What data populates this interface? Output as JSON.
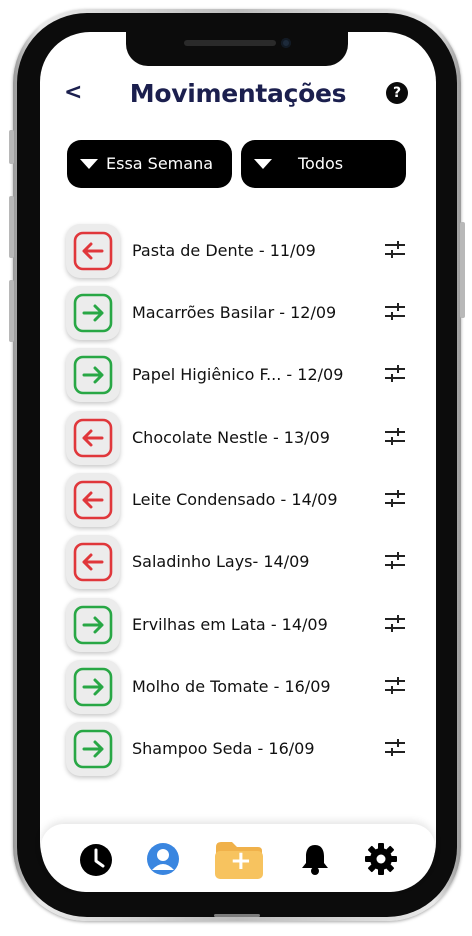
{
  "header": {
    "title": "Movimentações",
    "back_glyph": "<",
    "help_glyph": "?"
  },
  "filters": {
    "period": "Essa Semana",
    "type": "Todos"
  },
  "colors": {
    "title": "#1b1f4e",
    "outgoing": "#e0373b",
    "incoming": "#28a745",
    "filter_bg": "#000000",
    "folder": "#f7c35f",
    "profile": "#3a86e0"
  },
  "movements": [
    {
      "label": "Pasta de Dente - 11/09",
      "direction": "out",
      "icon": "arrow-left-icon"
    },
    {
      "label": "Macarrões Basilar - 12/09",
      "direction": "in",
      "icon": "arrow-right-icon"
    },
    {
      "label": "Papel Higiênico F... - 12/09",
      "direction": "in",
      "icon": "arrow-right-icon"
    },
    {
      "label": "Chocolate Nestle - 13/09",
      "direction": "out",
      "icon": "arrow-left-icon"
    },
    {
      "label": "Leite Condensado - 14/09",
      "direction": "out",
      "icon": "arrow-left-icon"
    },
    {
      "label": "Saladinho Lays- 14/09",
      "direction": "out",
      "icon": "arrow-left-icon"
    },
    {
      "label": "Ervilhas em Lata - 14/09",
      "direction": "in",
      "icon": "arrow-right-icon"
    },
    {
      "label": "Molho de Tomate - 16/09",
      "direction": "in",
      "icon": "arrow-right-icon"
    },
    {
      "label": "Shampoo Seda - 16/09",
      "direction": "in",
      "icon": "arrow-right-icon"
    }
  ],
  "bottom_nav": [
    {
      "icon": "clock-icon"
    },
    {
      "icon": "profile-icon"
    },
    {
      "icon": "add-folder-icon",
      "glyph": "+"
    },
    {
      "icon": "bell-icon"
    },
    {
      "icon": "gear-icon"
    }
  ]
}
